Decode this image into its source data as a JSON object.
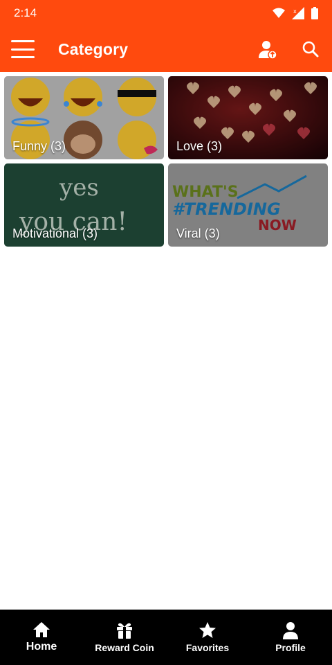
{
  "colors": {
    "primary": "#ff4a0e",
    "nav_bg": "#000000"
  },
  "status": {
    "time": "2:14",
    "icons": [
      "wifi-icon",
      "signal-icon",
      "battery-icon"
    ]
  },
  "appbar": {
    "title": "Category",
    "icons": [
      "menu-icon",
      "profile-upload-icon",
      "search-icon"
    ]
  },
  "categories": [
    {
      "label": "Funny (3)",
      "image": "emoji collage"
    },
    {
      "label": "Love (3)",
      "image": "hearts bokeh"
    },
    {
      "label": "Motivational (3)",
      "image": "yes you can! chalkboard",
      "image_text": [
        "yes",
        "you can!"
      ]
    },
    {
      "label": "Viral (3)",
      "image": "whats trending now",
      "image_text": [
        "WHAT'S",
        "#TRENDING",
        "NOW"
      ]
    }
  ],
  "bottom_nav": [
    {
      "label": "Home",
      "icon": "home-icon",
      "active": true
    },
    {
      "label": "Reward Coin",
      "icon": "gift-icon",
      "active": false
    },
    {
      "label": "Favorites",
      "icon": "star-icon",
      "active": false
    },
    {
      "label": "Profile",
      "icon": "person-icon",
      "active": false
    }
  ]
}
